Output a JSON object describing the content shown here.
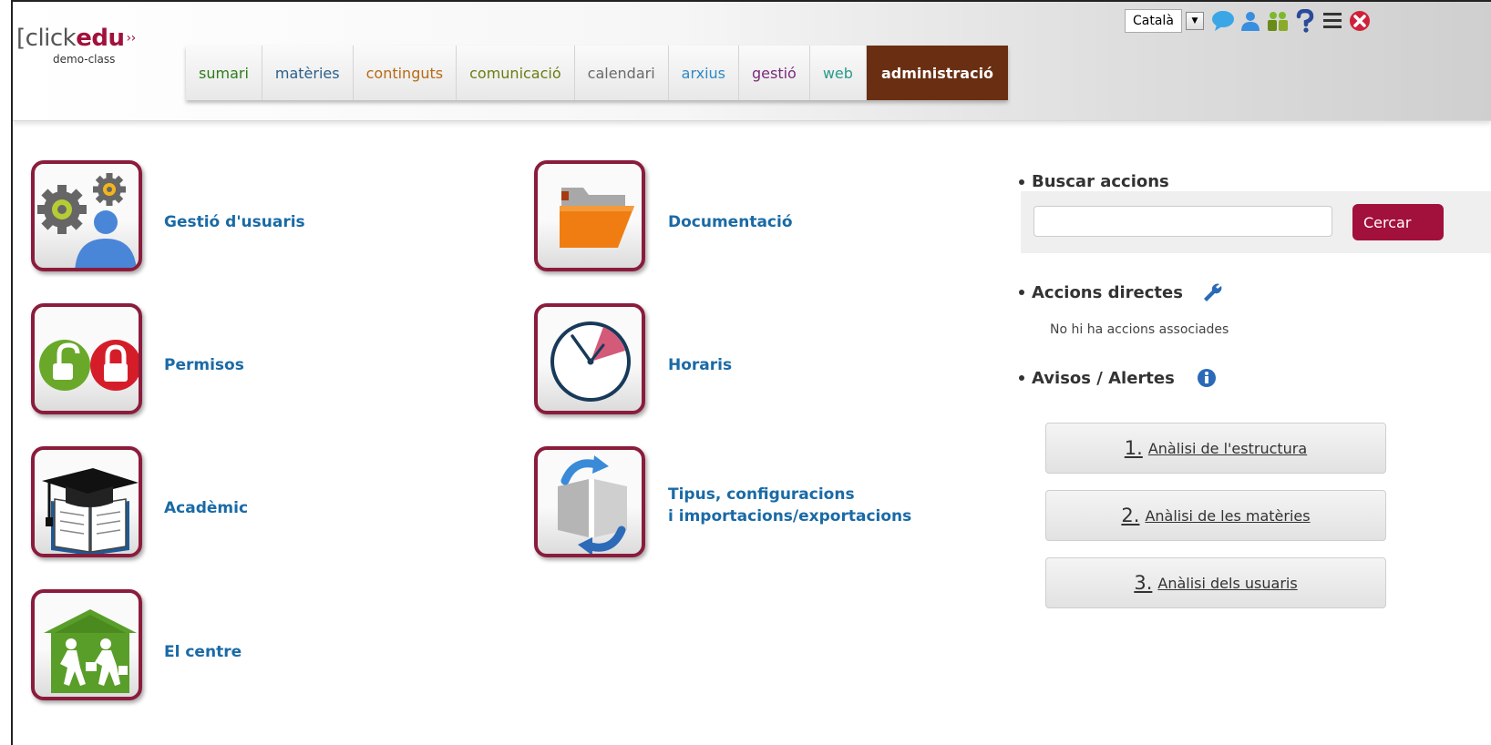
{
  "header": {
    "logo": {
      "prefix": "[click",
      "brand": "edu",
      "subtitle": "demo-class"
    },
    "tabs": [
      {
        "label": "sumari",
        "color": "#2e7d1a"
      },
      {
        "label": "matèries",
        "color": "#2a5f8a"
      },
      {
        "label": "continguts",
        "color": "#b86a14"
      },
      {
        "label": "comunicació",
        "color": "#6a7d10"
      },
      {
        "label": "calendari",
        "color": "#6a6a6a"
      },
      {
        "label": "arxius",
        "color": "#2d8ac6"
      },
      {
        "label": "gestió",
        "color": "#7a2a7a"
      },
      {
        "label": "web",
        "color": "#2a9a8a"
      },
      {
        "label": "administració",
        "color": "#ffffff",
        "active": true
      }
    ],
    "language": "Català",
    "toolbar_icons": [
      "chat-icon",
      "user-icon",
      "users-icon",
      "help-icon",
      "menu-icon",
      "close-icon"
    ]
  },
  "admin_links": {
    "users": "Gestió d'usuaris",
    "permissions": "Permisos",
    "academic": "Acadèmic",
    "centre": "El centre",
    "documentation": "Documentació",
    "schedules": "Horaris",
    "types_line1": "Tipus, configuracions",
    "types_line2": "i importacions/exportacions"
  },
  "sidebar": {
    "search_title": "Buscar accions",
    "search_value": "",
    "search_button": "Cercar",
    "direct_actions_title": "Accions directes",
    "no_actions": "No hi ha accions associades",
    "alerts_title": "Avisos / Alertes",
    "alerts": [
      {
        "num": "1.",
        "label": "Anàlisi de l'estructura"
      },
      {
        "num": "2.",
        "label": "Anàlisi de les matèries"
      },
      {
        "num": "3.",
        "label": "Anàlisi dels usuaris"
      }
    ]
  },
  "colors": {
    "accent": "#a2103c",
    "link": "#1a6aa6",
    "active_tab": "#6a2f12"
  }
}
